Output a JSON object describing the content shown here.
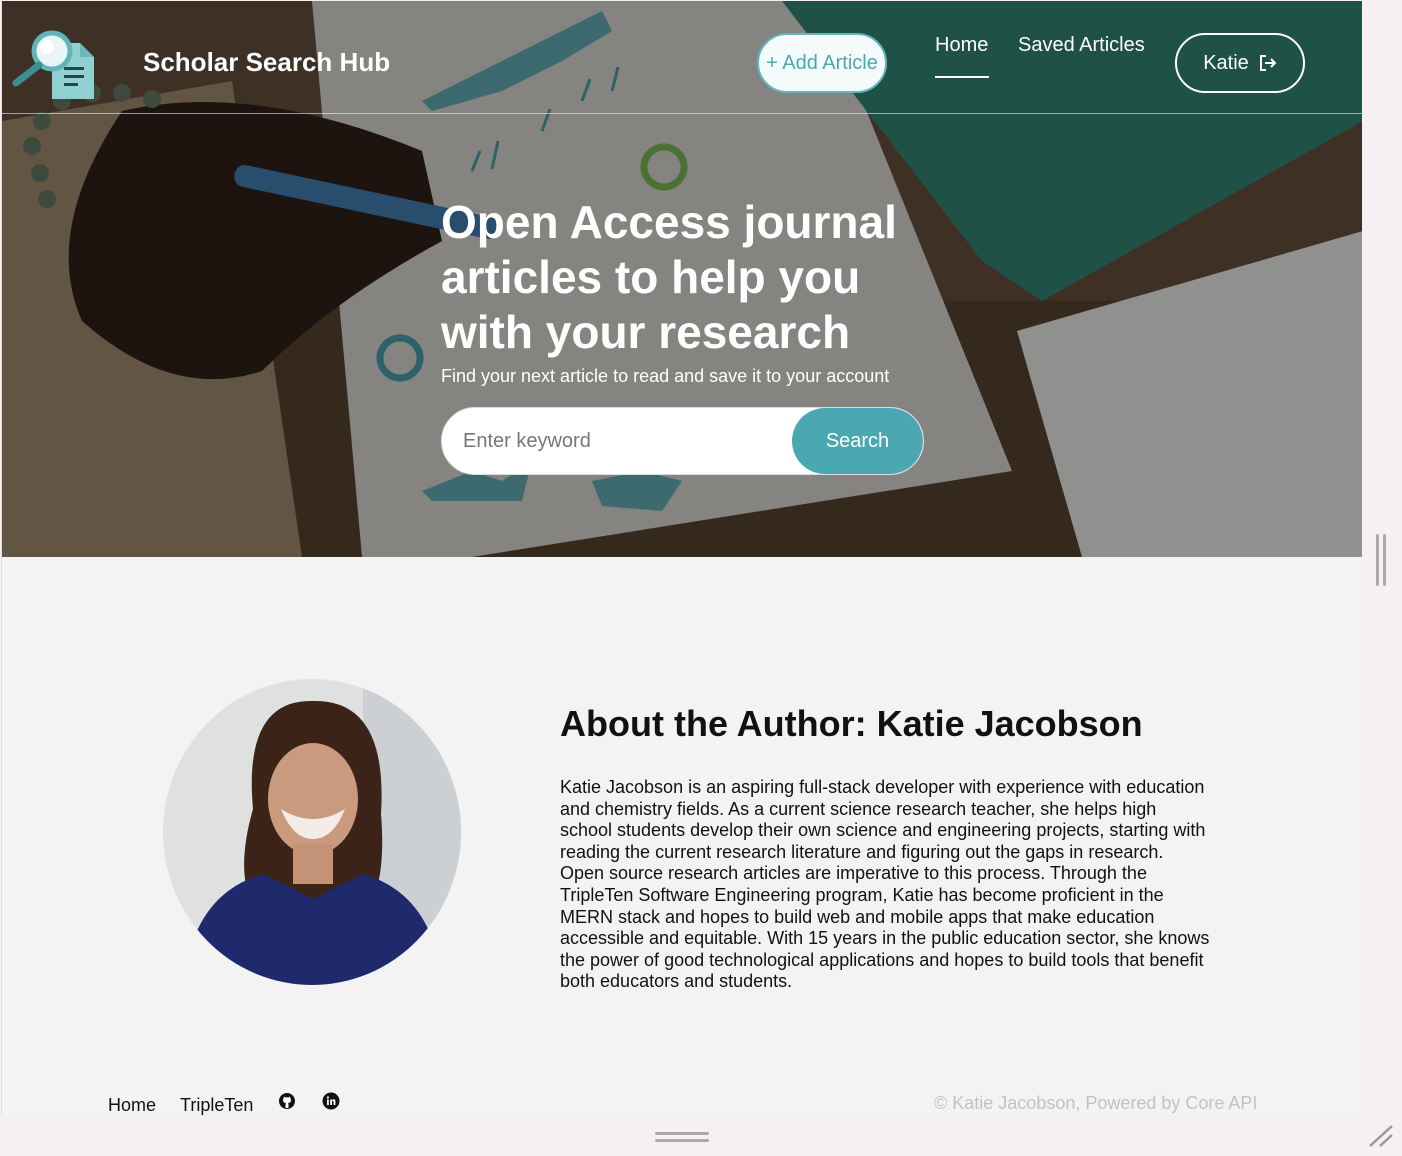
{
  "header": {
    "brand": "Scholar Search Hub",
    "add_article_label": "+ Add Article",
    "nav": {
      "home": "Home",
      "saved": "Saved Articles"
    },
    "user_name": "Katie"
  },
  "hero": {
    "title": "Open Access journal articles to help you with your research",
    "subtitle": "Find your next article to read and save it to your account",
    "search_placeholder": "Enter keyword",
    "search_value": "",
    "search_button": "Search"
  },
  "about": {
    "title": "About the Author: Katie Jacobson",
    "body": "Katie Jacobson is an aspiring full-stack developer with experience with education and chemistry fields. As a current science research teacher, she helps high school students develop their own science and engineering projects, starting with reading the current research literature and figuring out the gaps in research. Open source research articles are imperative to this process. Through the TripleTen Software Engineering program, Katie has become proficient in the MERN stack and hopes to build web and mobile apps that make education accessible and equitable. With 15 years in the public education sector, she knows the power of good technological applications and hopes to build tools that benefit both educators and students."
  },
  "footer": {
    "home": "Home",
    "tripleten": "TripleTen",
    "github_icon": "github-icon",
    "linkedin_icon": "linkedin-icon",
    "copyright": "© Katie Jacobson, Powered by Core API"
  },
  "colors": {
    "accent": "#4aa8b3",
    "page_bg": "#f3f3f3",
    "text": "#111111",
    "muted": "#c2c2c2"
  }
}
